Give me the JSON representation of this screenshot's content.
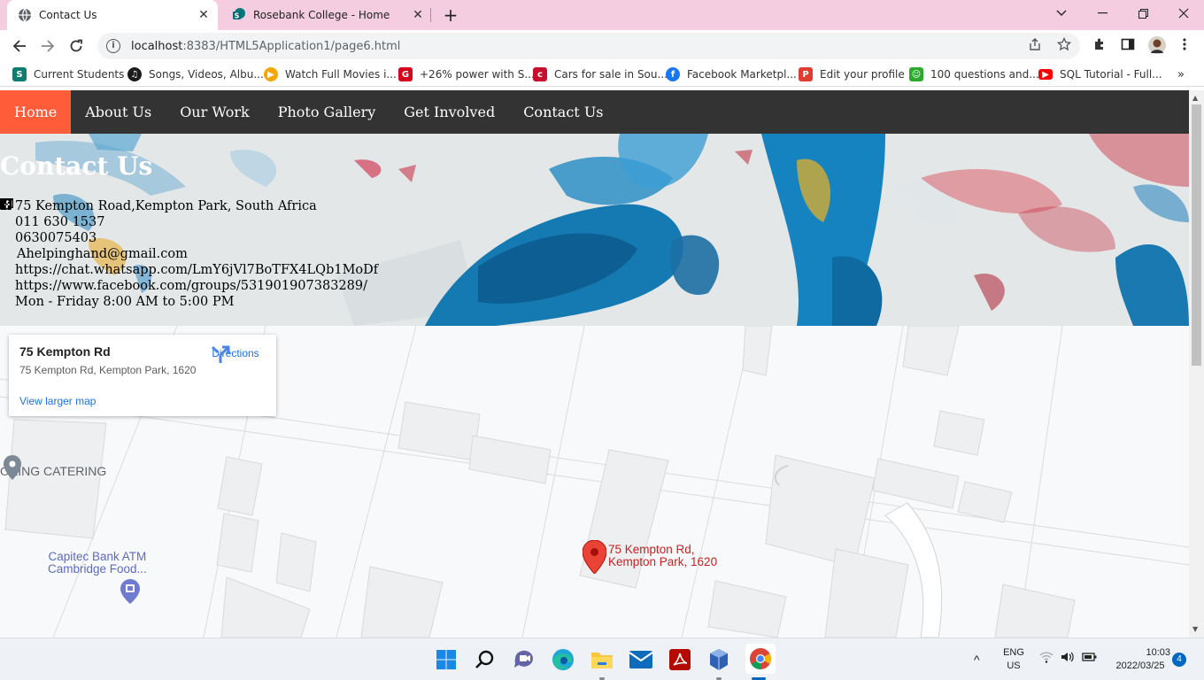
{
  "browser": {
    "tabs": [
      {
        "title": "Contact Us",
        "icon": "globe-icon",
        "active": true
      },
      {
        "title": "Rosebank College - Home",
        "icon": "sharepoint-icon",
        "active": false
      }
    ],
    "url_host": "localhost",
    "url_rest": ":8383/HTML5Application1/page6.html",
    "bookmarks": [
      {
        "label": "Current Students",
        "icon": "sharepoint-icon",
        "color": "#107c6f"
      },
      {
        "label": "Songs, Videos, Albu...",
        "icon": "music-icon",
        "color": "#1c1c1c"
      },
      {
        "label": "Watch Full Movies i...",
        "icon": "play-icon",
        "color": "#f7a600"
      },
      {
        "label": "+26% power with S...",
        "icon": "car-brand-icon",
        "color": "#d6001c"
      },
      {
        "label": "Cars for sale in Sou...",
        "icon": "cars-icon",
        "color": "#c8102e"
      },
      {
        "label": "Facebook Marketpl...",
        "icon": "facebook-icon",
        "color": "#1877f2"
      },
      {
        "label": "Edit your profile",
        "icon": "profile-icon",
        "color": "#e03c31"
      },
      {
        "label": "100 questions and...",
        "icon": "quiz-icon",
        "color": "#2bab2b"
      },
      {
        "label": "SQL Tutorial - Full...",
        "icon": "youtube-icon",
        "color": "#ff0000"
      }
    ]
  },
  "nav": {
    "items": [
      "Home",
      "About Us",
      "Our Work",
      "Photo Gallery",
      "Get Involved",
      "Contact Us"
    ]
  },
  "contact": {
    "heading": "Contact Us",
    "rows": [
      {
        "icon": "map-marker-icon",
        "text": "75 Kempton Road,Kempton Park, South Africa"
      },
      {
        "icon": "phone-icon",
        "text": "011 630 1537"
      },
      {
        "icon": "phone-icon",
        "text": "0630075403"
      },
      {
        "icon": "envelope-icon",
        "text": "Ahelpinghand@gmail.com"
      },
      {
        "icon": "whatsapp-icon",
        "text": "https://chat.whatsapp.com/LmY6jVl7BoTFX4LQb1MoDf"
      },
      {
        "icon": "facebook-square-icon",
        "text": "https://www.facebook.com/groups/531901907383289/"
      },
      {
        "icon": "clock-icon",
        "text": "Mon - Friday 8:00 AM to 5:00 PM"
      }
    ]
  },
  "map": {
    "card_title": "75 Kempton Rd",
    "card_address": "75 Kempton Rd, Kempton Park, 1620",
    "directions_label": "Directions",
    "larger_map_label": "View larger map",
    "place1": "OKING CATERING",
    "place2_line1": "Capitec Bank ATM",
    "place2_line2": "Cambridge Food...",
    "pin_line1": "75 Kempton Rd,",
    "pin_line2": "Kempton Park, 1620"
  },
  "taskbar": {
    "lang1": "ENG",
    "lang2": "US",
    "time": "10:03",
    "date": "2022/03/25",
    "notifications": "4"
  }
}
